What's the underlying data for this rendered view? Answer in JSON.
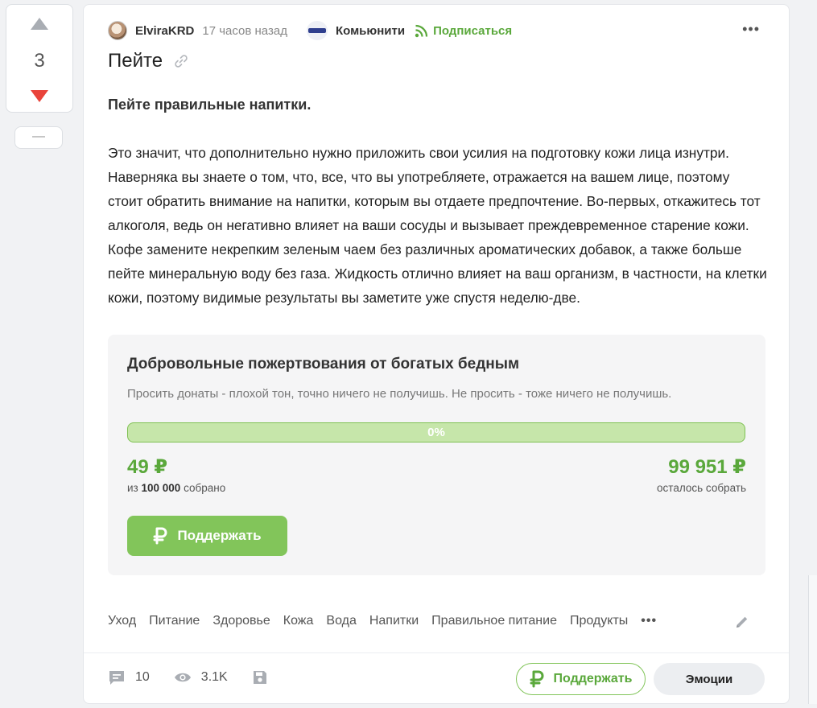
{
  "vote": {
    "count": "3"
  },
  "hide_label": "—",
  "post": {
    "author": "ElviraKRD",
    "time": "17 часов назад",
    "community": "Комьюнити",
    "subscribe": "Подписаться",
    "title": "Пейте",
    "subtitle": "Пейте правильные напитки.",
    "body": "Это значит, что дополнительно нужно приложить свои усилия на подготовку кожи лица изнутри. Наверняка вы знаете о том, что, все, что вы употребляете, отражается на вашем лице, поэтому стоит обратить внимание на напитки, которым вы отдаете предпочтение. Во-первых, откажитесь тот алкоголя, ведь он негативно влияет на ваши сосуды и вызывает преждевременное старение кожи. Кофе замените некрепким зеленым чаем без различных ароматических добавок, а также больше пейте минеральную воду без газа. Жидкость отлично влияет на ваш организм, в частности, на клетки кожи, поэтому видимые результаты вы заметите уже спустя неделю-две."
  },
  "donation": {
    "title": "Добровольные пожертвования от богатых бедным",
    "description": "Просить донаты - плохой тон, точно ничего не получишь. Не просить - тоже ничего не получишь.",
    "progress_fraction": 0.0,
    "progress_label": "0%",
    "raised": "49 ₽",
    "raised_prefix": "из",
    "goal": "100 000",
    "raised_suffix": "собрано",
    "remaining": "99 951 ₽",
    "remaining_note": "осталось собрать",
    "button": "Поддержать"
  },
  "tags": [
    "Уход",
    "Питание",
    "Здоровье",
    "Кожа",
    "Вода",
    "Напитки",
    "Правильное питание",
    "Продукты"
  ],
  "tags_more": "•••",
  "footer": {
    "comments": "10",
    "views": "3.1K",
    "support": "Поддержать",
    "emotions": "Эмоции"
  },
  "colors": {
    "accent_green": "#82c55a",
    "text_green": "#5aa83b",
    "downvote_red": "#e9433a"
  }
}
